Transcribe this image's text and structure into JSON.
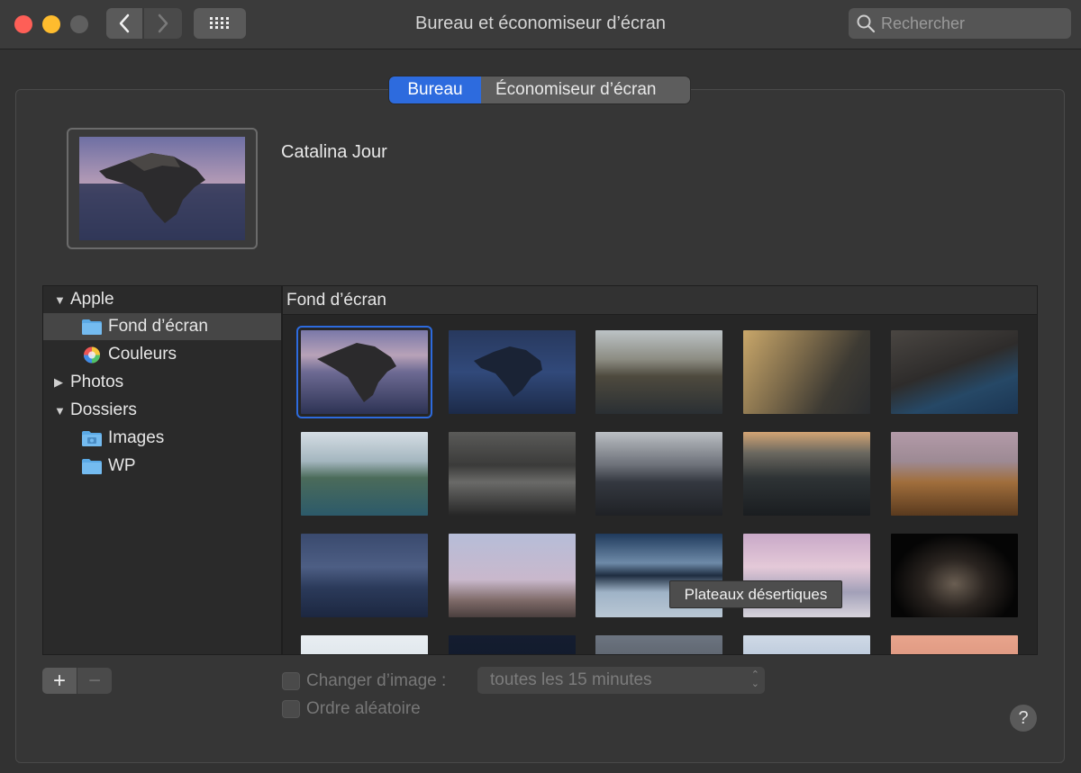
{
  "window": {
    "title": "Bureau et économiseur d’écran",
    "search_placeholder": "Rechercher"
  },
  "tabs": [
    {
      "label": "Bureau",
      "active": true
    },
    {
      "label": "Économiseur d’écran",
      "active": false
    }
  ],
  "preview": {
    "name": "Catalina Jour"
  },
  "sidebar": {
    "items": [
      {
        "label": "Apple",
        "type": "group",
        "expanded": true
      },
      {
        "label": "Fond d’écran",
        "type": "folder",
        "selected": true
      },
      {
        "label": "Couleurs",
        "type": "colors"
      },
      {
        "label": "Photos",
        "type": "group",
        "expanded": false
      },
      {
        "label": "Dossiers",
        "type": "group",
        "expanded": true
      },
      {
        "label": "Images",
        "type": "folder"
      },
      {
        "label": "WP",
        "type": "folder"
      }
    ]
  },
  "gallery": {
    "header": "Fond d’écran",
    "tooltip": "Plateaux désertiques"
  },
  "controls": {
    "add_label": "+",
    "remove_label": "−",
    "change_picture_label": "Changer d’image :",
    "change_picture_checked": false,
    "interval_value": "toutes les 15 minutes",
    "random_order_label": "Ordre aléatoire",
    "random_order_checked": false,
    "help_label": "?"
  },
  "colors": {
    "accent": "#2d6bde",
    "close": "#fe5f57",
    "minimize": "#febc2e"
  }
}
